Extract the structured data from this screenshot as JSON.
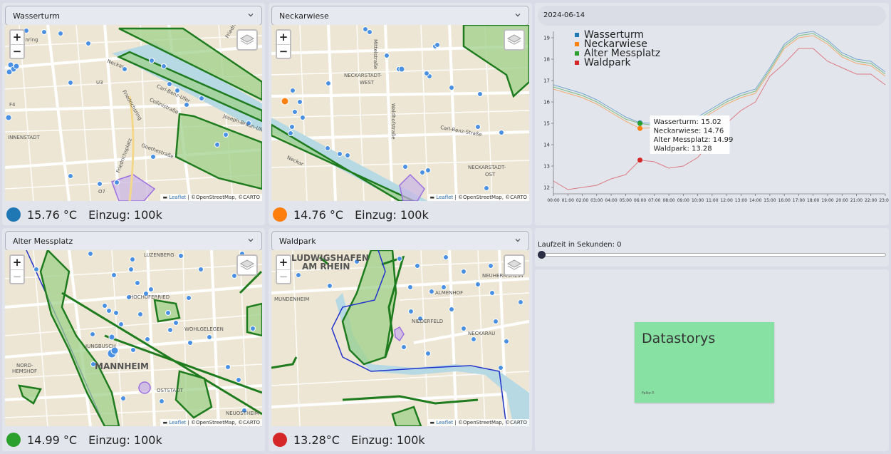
{
  "panels": [
    {
      "select_label": "Wasserturm",
      "readout": {
        "temp": "15.76 °C",
        "einzug": "Einzug: 100k",
        "dot_color": "#1f77b4"
      },
      "map": {
        "labels": [
          "Friedrichsb",
          "Jesenring",
          "U3",
          "Carl-Benz-Ufer",
          "Neckar",
          "Collinistraße",
          "Friedrichsring",
          "F4",
          "INNENSTADT",
          "Goethestraße",
          "Friedrichsplatz",
          "O7",
          "Joseph-Braun-Ufer"
        ]
      }
    },
    {
      "select_label": "Neckarwiese",
      "readout": {
        "temp": "14.76 °C",
        "einzug": "Einzug: 100k",
        "dot_color": "#ff7f0e"
      },
      "map": {
        "labels": [
          "NECKARSTADT-",
          "WEST",
          "Carl-Benz-Straße",
          "NECKARSTADT-",
          "OST",
          "Neckar",
          "Waldhofstraße",
          "Mittelstraße"
        ]
      }
    },
    {
      "select_label": "Alter Messplatz",
      "readout": {
        "temp": "14.99 °C",
        "einzug": "Einzug: 100k",
        "dot_color": "#2ca02c"
      },
      "map": {
        "labels": [
          "LUZENBERG",
          "HOCHUFERRIED",
          "WOHLGELEGEN",
          "JUNGBUSCH",
          "MANNHEIM",
          "NORD-",
          "HEMSHOF",
          "OSTSTADT",
          "NEUOSTHEIM"
        ]
      }
    },
    {
      "select_label": "Waldpark",
      "readout": {
        "temp": "13.28°C",
        "einzug": "Einzug: 100k",
        "dot_color": "#d62728"
      },
      "map": {
        "labels": [
          "LUDWIGSHAFEN",
          "AM RHEIN",
          "NEUHERMSHEIM",
          "MUNDENHEIM",
          "ALMENHOF",
          "NIEDERFELD",
          "NECKARAU"
        ]
      }
    }
  ],
  "map_common": {
    "zoom_in": "+",
    "zoom_out": "−",
    "attribution_leaflet": "Leaflet",
    "attribution_rest": " | ©OpenStreetMap, ©CARTO"
  },
  "chart_header": {
    "date": "2024-06-14"
  },
  "chart_data": {
    "type": "line",
    "x": [
      "00:00",
      "01:00",
      "02:00",
      "03:00",
      "04:00",
      "05:00",
      "06:00",
      "07:00",
      "08:00",
      "09:00",
      "10:00",
      "11:00",
      "12:00",
      "13:00",
      "14:00",
      "15:00",
      "16:00",
      "17:00",
      "18:00",
      "19:00",
      "20:00",
      "21:00",
      "22:00",
      "23:00"
    ],
    "series": [
      {
        "name": "Wasserturm",
        "color": "#1f77b4",
        "values": [
          16.8,
          16.6,
          16.4,
          16.1,
          15.7,
          15.3,
          15.02,
          15.0,
          15.0,
          15.1,
          15.3,
          15.7,
          16.1,
          16.4,
          16.6,
          17.6,
          18.7,
          19.2,
          19.3,
          18.9,
          18.3,
          18.0,
          17.9,
          17.4
        ]
      },
      {
        "name": "Neckarwiese",
        "color": "#ff7f0e",
        "values": [
          16.6,
          16.4,
          16.2,
          15.9,
          15.5,
          15.1,
          14.76,
          14.8,
          14.8,
          14.9,
          15.1,
          15.5,
          15.9,
          16.2,
          16.4,
          17.4,
          18.5,
          19.0,
          19.1,
          18.7,
          18.1,
          17.8,
          17.7,
          17.2
        ]
      },
      {
        "name": "Alter Messplatz",
        "color": "#2ca02c",
        "values": [
          16.7,
          16.5,
          16.3,
          16.0,
          15.6,
          15.2,
          14.99,
          14.9,
          14.9,
          15.0,
          15.2,
          15.6,
          16.0,
          16.3,
          16.5,
          17.5,
          18.6,
          19.1,
          19.2,
          18.8,
          18.2,
          17.9,
          17.8,
          17.3
        ]
      },
      {
        "name": "Waldpark",
        "color": "#d62728",
        "values": [
          12.3,
          11.9,
          12.0,
          12.1,
          12.4,
          12.6,
          13.28,
          13.2,
          12.9,
          13.0,
          13.4,
          14.2,
          15.0,
          15.6,
          16.0,
          17.2,
          17.8,
          18.5,
          18.5,
          17.9,
          17.6,
          17.3,
          17.3,
          16.8
        ]
      }
    ],
    "ylim": [
      11.7,
      19.3
    ],
    "yticks": [
      12,
      13,
      14,
      15,
      16,
      17,
      18,
      19
    ],
    "legend": "top-left",
    "tooltip": {
      "x": "06:00",
      "lines": [
        "Wasserturm: 15.02",
        "Neckarwiese: 14.76",
        "Alter Messplatz: 14.99",
        "Waldpark: 13.28"
      ]
    }
  },
  "slider": {
    "label": "Laufzeit in Sekunden: 0",
    "value": 0
  },
  "story": {
    "title": "Datastorys",
    "author": "Falko P."
  }
}
